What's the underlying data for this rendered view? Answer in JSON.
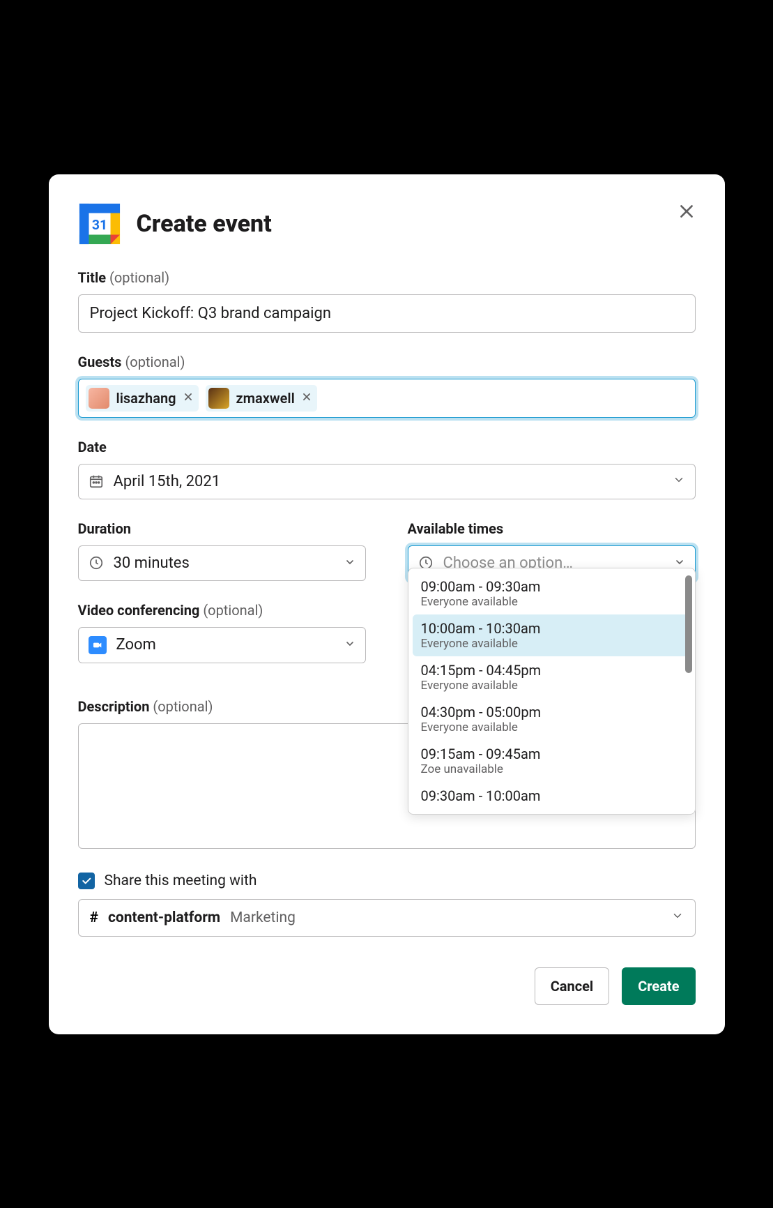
{
  "header": {
    "title": "Create event"
  },
  "title_field": {
    "label": "Title",
    "optional": "(optional)",
    "value": "Project Kickoff: Q3 brand campaign"
  },
  "guests_field": {
    "label": "Guests",
    "optional": "(optional)",
    "chips": [
      {
        "name": "lisazhang"
      },
      {
        "name": "zmaxwell"
      }
    ]
  },
  "date_field": {
    "label": "Date",
    "value": "April 15th, 2021"
  },
  "duration_field": {
    "label": "Duration",
    "value": "30 minutes"
  },
  "available_times": {
    "label": "Available times",
    "placeholder": "Choose an option…",
    "options": [
      {
        "time": "09:00am - 09:30am",
        "sub": "Everyone available"
      },
      {
        "time": "10:00am - 10:30am",
        "sub": "Everyone available",
        "highlight": true
      },
      {
        "time": "04:15pm - 04:45pm",
        "sub": "Everyone available"
      },
      {
        "time": "04:30pm - 05:00pm",
        "sub": "Everyone available"
      },
      {
        "time": "09:15am - 09:45am",
        "sub": "Zoe unavailable"
      },
      {
        "time": "09:30am - 10:00am",
        "sub": ""
      }
    ]
  },
  "video_field": {
    "label": "Video conferencing",
    "optional": "(optional)",
    "value": "Zoom"
  },
  "description_field": {
    "label": "Description",
    "optional": "(optional)",
    "value": ""
  },
  "share": {
    "checked": true,
    "label": "Share this meeting with",
    "channel": "content-platform",
    "group": "Marketing"
  },
  "footer": {
    "cancel": "Cancel",
    "create": "Create"
  }
}
